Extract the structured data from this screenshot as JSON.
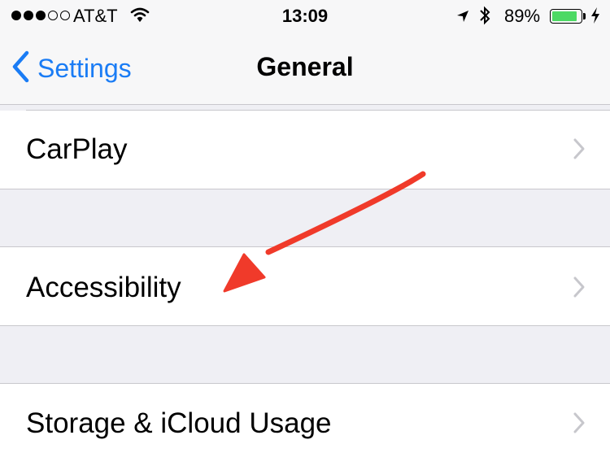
{
  "status_bar": {
    "signal_filled": 3,
    "signal_empty": 2,
    "carrier": "AT&T",
    "time": "13:09",
    "battery_percent": "89%",
    "battery_level": 0.89,
    "icons": [
      "wifi-icon",
      "location-arrow-icon",
      "bluetooth-icon",
      "charging-bolt-icon"
    ]
  },
  "nav": {
    "back_label": "Settings",
    "title": "General"
  },
  "rows": {
    "carplay": "CarPlay",
    "accessibility": "Accessibility",
    "storage": "Storage & iCloud Usage"
  },
  "colors": {
    "accent": "#1a7cf5",
    "annotation_arrow": "#f03a2a",
    "battery": "#4cd964",
    "group_background": "#efeff4"
  }
}
